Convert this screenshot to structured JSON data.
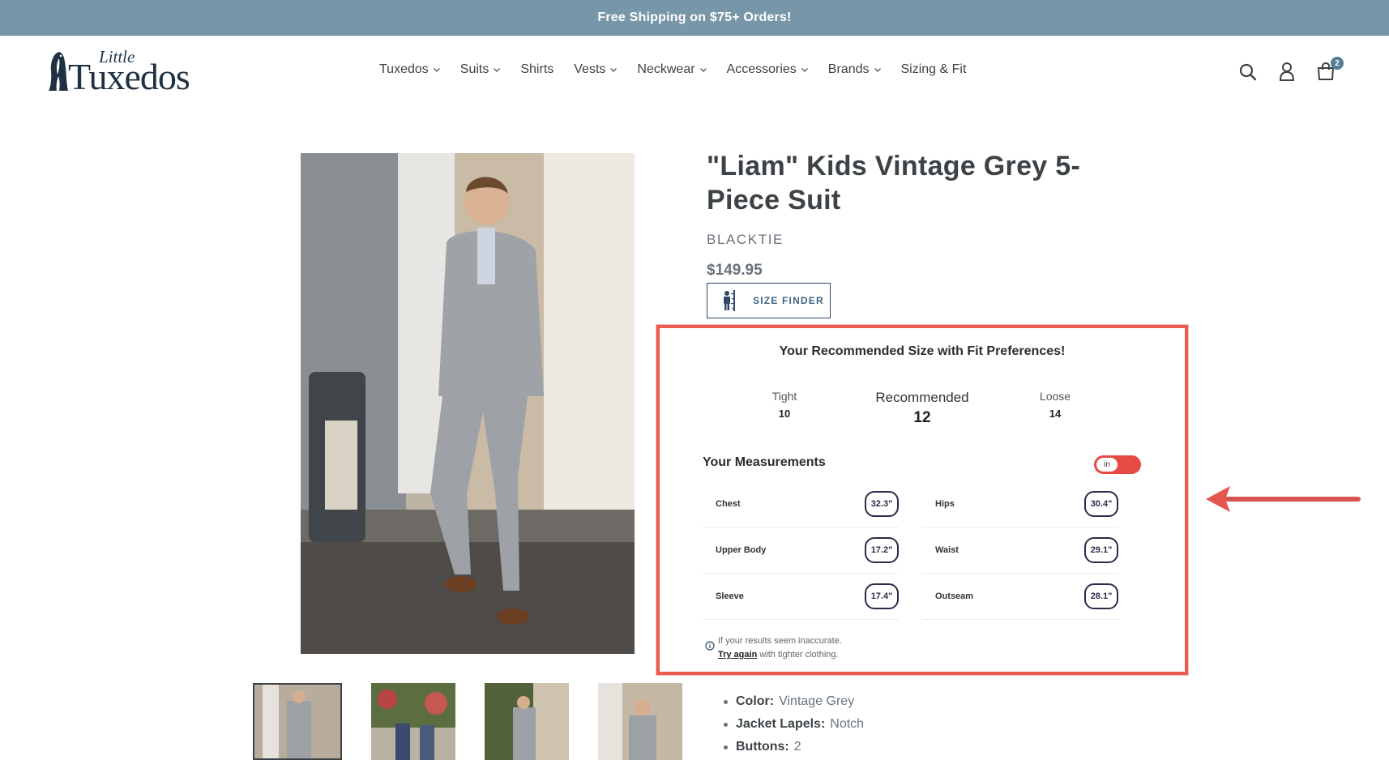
{
  "announcement": {
    "text": "Free Shipping on $75+ Orders!"
  },
  "header": {
    "logo_small": "Little",
    "logo_main": "Tuxedos",
    "nav": [
      {
        "label": "Tuxedos",
        "dropdown": true
      },
      {
        "label": "Suits",
        "dropdown": true
      },
      {
        "label": "Shirts",
        "dropdown": false
      },
      {
        "label": "Vests",
        "dropdown": true
      },
      {
        "label": "Neckwear",
        "dropdown": true
      },
      {
        "label": "Accessories",
        "dropdown": true
      },
      {
        "label": "Brands",
        "dropdown": true
      },
      {
        "label": "Sizing & Fit",
        "dropdown": false
      }
    ],
    "icons": [
      "search-icon",
      "account-icon",
      "cart-icon"
    ],
    "cart_count": "2"
  },
  "product": {
    "title": "\"Liam\" Kids Vintage Grey 5-Piece Suit",
    "vendor": "BLACKTIE",
    "price": "$149.95",
    "size_finder_label": "SIZE FINDER"
  },
  "recommendation": {
    "title": "Your Recommended Size with Fit Preferences!",
    "tight": {
      "label": "Tight",
      "value": "10"
    },
    "recommended": {
      "label": "Recommended",
      "value": "12"
    },
    "loose": {
      "label": "Loose",
      "value": "14"
    },
    "measurements_title": "Your Measurements",
    "unit": "in",
    "measurements_left": [
      {
        "label": "Chest",
        "value": "32.3\""
      },
      {
        "label": "Upper Body",
        "value": "17.2\""
      },
      {
        "label": "Sleeve",
        "value": "17.4\""
      }
    ],
    "measurements_right": [
      {
        "label": "Hips",
        "value": "30.4\""
      },
      {
        "label": "Waist",
        "value": "29.1\""
      },
      {
        "label": "Outseam",
        "value": "28.1\""
      }
    ],
    "note_line1": "If your results seem inaccurate.",
    "note_link": "Try again",
    "note_line2_rest": " with tighter clothing."
  },
  "specs": [
    {
      "label": "Color:",
      "value": "Vintage Grey"
    },
    {
      "label": "Jacket Lapels:",
      "value": "Notch"
    },
    {
      "label": "Buttons:",
      "value": "2"
    }
  ],
  "colors": {
    "accent": "#ec5b50",
    "announcement_bg": "#7796a8",
    "navy": "#2e4a6b"
  }
}
